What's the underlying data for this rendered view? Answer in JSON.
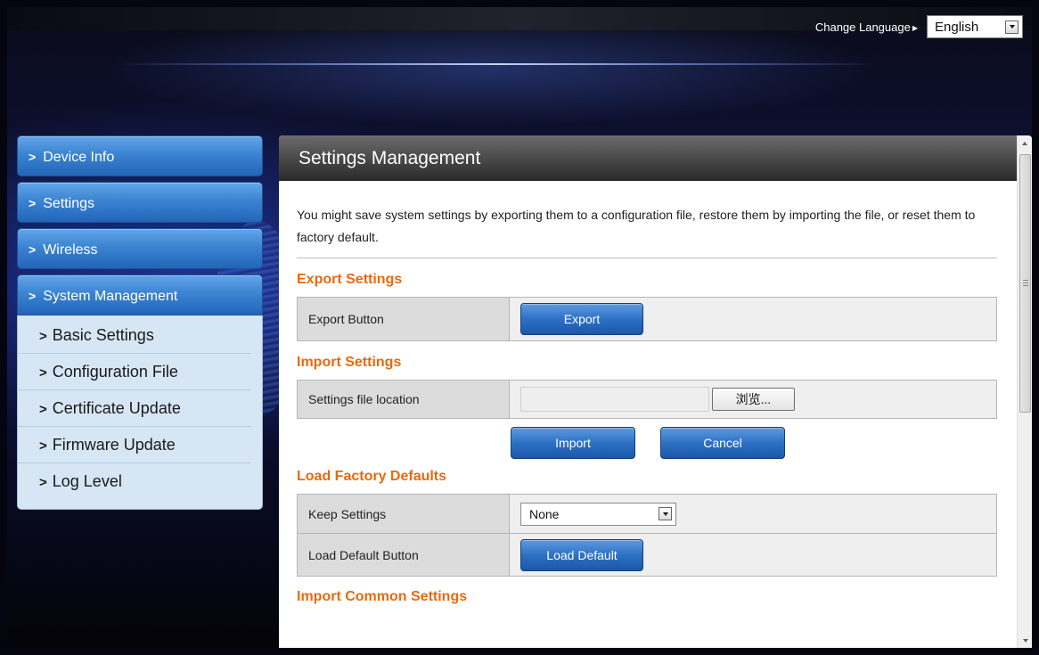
{
  "header": {
    "change_language_label": "Change Language",
    "language_value": "English"
  },
  "sidebar": {
    "items": [
      {
        "label": "Device Info"
      },
      {
        "label": "Settings"
      },
      {
        "label": "Wireless"
      },
      {
        "label": "System Management"
      }
    ],
    "sub_items": [
      {
        "label": "Basic Settings"
      },
      {
        "label": "Configuration File"
      },
      {
        "label": "Certificate Update"
      },
      {
        "label": "Firmware Update"
      },
      {
        "label": "Log Level"
      }
    ]
  },
  "main": {
    "title": "Settings Management",
    "intro": "You might save system settings by exporting them to a configuration file, restore them by importing the file, or reset them to factory default.",
    "export": {
      "title": "Export Settings",
      "row_label": "Export Button",
      "button": "Export"
    },
    "import": {
      "title": "Import Settings",
      "row_label": "Settings file location",
      "browse_button": "浏览...",
      "import_button": "Import",
      "cancel_button": "Cancel"
    },
    "factory": {
      "title": "Load Factory Defaults",
      "keep_label": "Keep Settings",
      "keep_value": "None",
      "load_label": "Load Default Button",
      "load_button": "Load Default"
    },
    "common": {
      "title": "Import Common Settings"
    }
  }
}
